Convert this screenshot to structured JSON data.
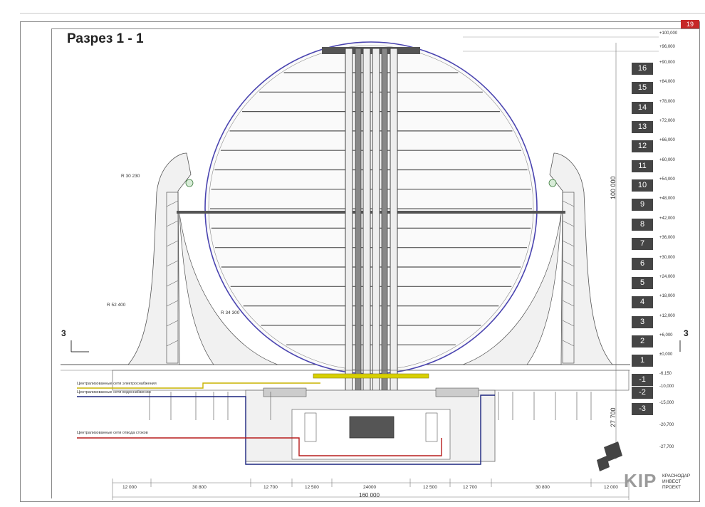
{
  "page_number": "19",
  "title": "Разрез 1 - 1",
  "section_mark": "3",
  "radii": [
    "R 30 230",
    "R 52 400",
    "R 34 300"
  ],
  "levels": [
    {
      "label": "16",
      "mark": "+90,000"
    },
    {
      "label": "15",
      "mark": "+84,000"
    },
    {
      "label": "14",
      "mark": "+78,000"
    },
    {
      "label": "13",
      "mark": "+72,000"
    },
    {
      "label": "12",
      "mark": "+66,000"
    },
    {
      "label": "11",
      "mark": "+60,000"
    },
    {
      "label": "10",
      "mark": "+54,000"
    },
    {
      "label": "9",
      "mark": "+48,000"
    },
    {
      "label": "8",
      "mark": "+42,000"
    },
    {
      "label": "7",
      "mark": "+36,000"
    },
    {
      "label": "6",
      "mark": "+30,000"
    },
    {
      "label": "5",
      "mark": "+24,000"
    },
    {
      "label": "4",
      "mark": "+18,000"
    },
    {
      "label": "3",
      "mark": "+12,000"
    },
    {
      "label": "2",
      "mark": "+6,000"
    },
    {
      "label": "1",
      "mark": "±0,000"
    },
    {
      "label": "-1",
      "mark": "-6,150"
    },
    {
      "label": "-2",
      "mark": "-10,000"
    },
    {
      "label": "-3",
      "mark": "-15,000"
    }
  ],
  "top_marks": [
    "+100,000",
    "+96,000"
  ],
  "bottom_marks": [
    "-20,700",
    "-27,700"
  ],
  "vertical_dims": [
    "100 000",
    "27 700"
  ],
  "utility_notes": [
    "Централизованные сети электроснабжения",
    "Централизованные сети водоснабжения",
    "Централизованные сети отвода стоков"
  ],
  "bottom_dims": [
    "12 000",
    "30 800",
    "12 700",
    "12 500",
    "24000",
    "12 500",
    "12 700",
    "30 800",
    "12 000"
  ],
  "total_dim": "160 000",
  "logo": {
    "mark": "KIP",
    "line1": "КРАСНОДАР",
    "line2": "ИНВЕСТ",
    "line3": "ПРОЕКТ"
  },
  "colors": {
    "sphere": "#4a44b0",
    "power": "#c9b400",
    "water": "#1a237e",
    "sewer": "#b71c1c",
    "level_box": "#454545",
    "accent": "#c62828"
  }
}
